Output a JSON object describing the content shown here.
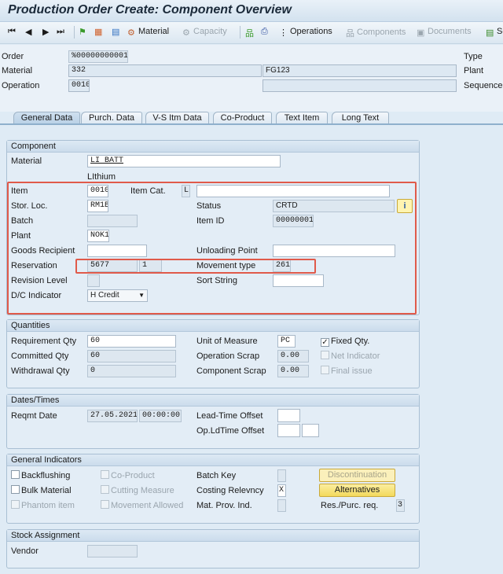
{
  "title": "Production Order Create: Component Overview",
  "toolbar": {
    "material": "Material",
    "capacity": "Capacity",
    "operations": "Operations",
    "components": "Components",
    "documents": "Documents",
    "se": "Se"
  },
  "header": {
    "order_label": "Order",
    "order_value": "%00000000001",
    "material_label": "Material",
    "material_value": "332",
    "material_desc": "FG123",
    "operation_label": "Operation",
    "operation_value": "0010",
    "operation_desc": "",
    "type_label": "Type",
    "plant_label": "Plant",
    "sequence_label": "Sequence"
  },
  "tabs": [
    "General Data",
    "Purch. Data",
    "V-S Itm Data",
    "Co-Product",
    "Text Item",
    "Long Text"
  ],
  "component": {
    "title": "Component",
    "material_label": "Material",
    "material_value": "LI BATT",
    "material_desc": "LIthium",
    "item_label": "Item",
    "item_value": "0010",
    "item_cat_label": "Item Cat.",
    "item_cat_value": "L",
    "item_text": "",
    "stor_loc_label": "Stor. Loc.",
    "stor_loc_value": "RM1B",
    "status_label": "Status",
    "status_value": "CRTD",
    "batch_label": "Batch",
    "batch_value": "",
    "item_id_label": "Item ID",
    "item_id_value": "00000001",
    "plant_label": "Plant",
    "plant_value": "NOK1",
    "goods_recipient_label": "Goods Recipient",
    "goods_recipient_value": "",
    "unloading_point_label": "Unloading Point",
    "unloading_point_value": "",
    "reservation_label": "Reservation",
    "reservation_value": "5677",
    "reservation_item": "1",
    "movement_type_label": "Movement type",
    "movement_type_value": "261",
    "revision_level_label": "Revision Level",
    "sort_string_label": "Sort String",
    "dc_indicator_label": "D/C Indicator",
    "dc_indicator_value": "H Credit"
  },
  "quantities": {
    "title": "Quantities",
    "requirement_qty_label": "Requirement Qty",
    "requirement_qty_value": "60",
    "committed_qty_label": "Committed Qty",
    "committed_qty_value": "60",
    "withdrawal_qty_label": "Withdrawal Qty",
    "withdrawal_qty_value": "0",
    "uom_label": "Unit of Measure",
    "uom_value": "PC",
    "op_scrap_label": "Operation Scrap",
    "op_scrap_value": "0.00",
    "comp_scrap_label": "Component Scrap",
    "comp_scrap_value": "0.00",
    "fixed_qty_label": "Fixed Qty.",
    "fixed_qty_checked": true,
    "net_indicator_label": "Net Indicator",
    "final_issue_label": "Final issue"
  },
  "dates": {
    "title": "Dates/Times",
    "reqmt_date_label": "Reqmt Date",
    "reqmt_date_value": "27.05.2021",
    "reqmt_time_value": "00:00:00",
    "lead_time_offset_label": "Lead-Time Offset",
    "op_ld_time_offset_label": "Op.LdTime Offset"
  },
  "indicators": {
    "title": "General Indicators",
    "backflushing": "Backflushing",
    "bulk_material": "Bulk Material",
    "phantom_item": "Phantom item",
    "co_product": "Co-Product",
    "cutting_measure": "Cutting Measure",
    "movement_allowed": "Movement Allowed",
    "batch_key_label": "Batch Key",
    "costing_relevancy_label": "Costing Relevncy",
    "costing_relevancy_value": "X",
    "mat_prov_ind_label": "Mat. Prov. Ind.",
    "discontinuation_button": "Discontinuation",
    "alternatives_button": "Alternatives",
    "res_purc_req_label": "Res./Purc. req.",
    "res_purc_req_value": "3"
  },
  "stock": {
    "title": "Stock Assignment",
    "vendor_label": "Vendor",
    "vendor_value": ""
  },
  "colors": {
    "highlight": "#e05a4a",
    "button_yellow": "#f7e27a"
  }
}
